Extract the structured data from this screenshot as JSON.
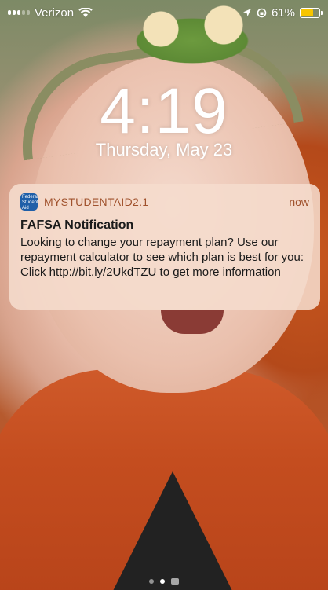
{
  "status_bar": {
    "carrier": "Verizon",
    "battery_percent": "61%",
    "battery_level": 0.61,
    "battery_color": "#f7c500"
  },
  "lock_screen": {
    "time": "4:19",
    "date": "Thursday, May 23"
  },
  "notification": {
    "app_icon": "student-aid-icon",
    "app_icon_text": "Federal Student Aid",
    "app_name": "MYSTUDENTAID2.1",
    "time": "now",
    "title": "FAFSA Notification",
    "body": "Looking to change your repayment plan? Use our repayment calculator to see which plan is best for you: Click http://bit.ly/2UkdTZU to get more information"
  },
  "page_indicator": {
    "pages": 2,
    "active_index": 1
  },
  "colors": {
    "accent": "#a0522d"
  }
}
